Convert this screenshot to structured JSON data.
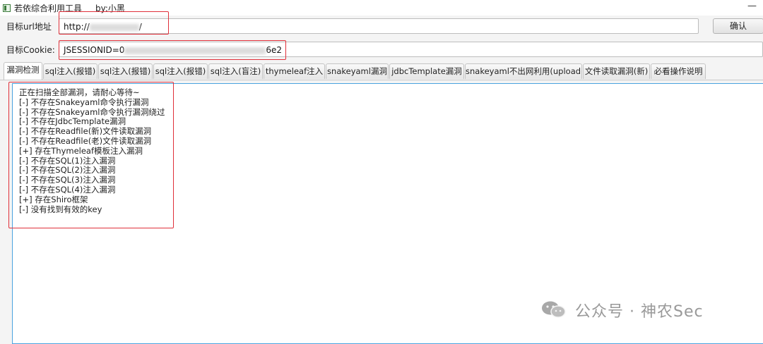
{
  "window": {
    "title": "若依综合利用工具",
    "author": "by:小黑",
    "minimize_glyph": "—"
  },
  "form": {
    "url_label": "目标url地址",
    "url_value_prefix": "http://",
    "url_value_suffix": "/",
    "cookie_label": "目标Cookie:",
    "cookie_value_prefix": "JSESSIONID=0",
    "cookie_value_suffix": "6e2",
    "confirm_label": "确认"
  },
  "tabs": [
    {
      "label": "漏洞检测",
      "active": true
    },
    {
      "label": "sql注入(报错)"
    },
    {
      "label": "sql注入(报错)"
    },
    {
      "label": "sql注入(报错)"
    },
    {
      "label": "sql注入(盲注)"
    },
    {
      "label": "thymeleaf注入"
    },
    {
      "label": "snakeyaml漏洞"
    },
    {
      "label": "jdbcTemplate漏洞"
    },
    {
      "label": "snakeyaml不出网利用(upload)"
    },
    {
      "label": "文件读取漏洞(新)"
    },
    {
      "label": "必看操作说明"
    }
  ],
  "output": {
    "lines": [
      "正在扫描全部漏洞，请耐心等待~",
      "[-] 不存在Snakeyaml命令执行漏洞",
      "[-] 不存在Snakeyaml命令执行漏洞绕过",
      "[-] 不存在JdbcTemplate漏洞",
      "[-] 不存在Readfile(新)文件读取漏洞",
      "[-] 不存在Readfile(老)文件读取漏洞",
      "[+] 存在Thymeleaf模板注入漏洞",
      "[-] 不存在SQL(1)注入漏洞",
      "[-] 不存在SQL(2)注入漏洞",
      "[-] 不存在SQL(3)注入漏洞",
      "[-] 不存在SQL(4)注入漏洞",
      "[+] 存在Shiro框架",
      "[-] 没有找到有效的key"
    ]
  },
  "watermark": {
    "text": "公众号 · 神农Sec",
    "icon": "wechat-icon"
  },
  "colors": {
    "highlight_box": "#e0303a",
    "output_border": "#4aa3df"
  }
}
